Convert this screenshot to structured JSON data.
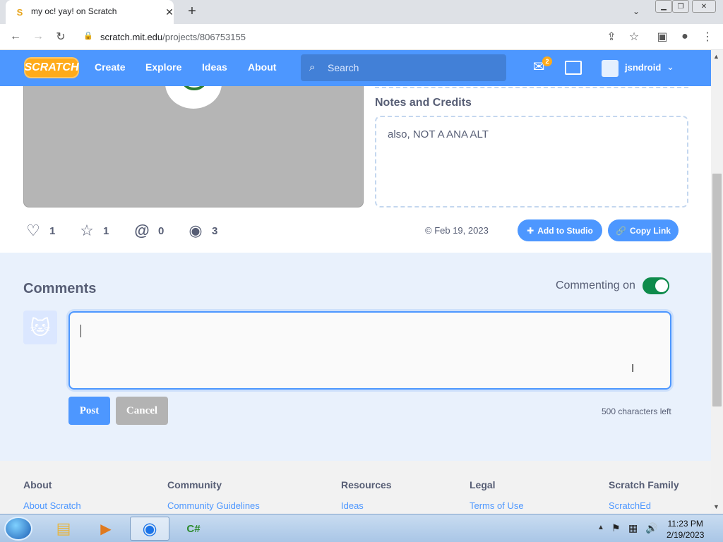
{
  "browser": {
    "tab_title": "my oc! yay! on Scratch",
    "new_tab": "+",
    "url_domain": "scratch.mit.edu",
    "url_path": "/projects/806753155"
  },
  "nav": {
    "logo": "SCRATCH",
    "links": [
      "Create",
      "Explore",
      "Ideas",
      "About"
    ],
    "search_placeholder": "Search",
    "message_count": "2",
    "username": "jsndroid"
  },
  "project": {
    "notes_heading": "Notes and Credits",
    "notes_text": "also, NOT A ANA ALT",
    "stats": {
      "loves": "1",
      "favorites": "1",
      "remixes": "0",
      "views": "3"
    },
    "date": "© Feb 19, 2023",
    "add_to_studio": "Add to Studio",
    "copy_link": "Copy Link"
  },
  "comments": {
    "heading": "Comments",
    "commenting_label": "Commenting on",
    "commenting_enabled": true,
    "post_label": "Post",
    "cancel_label": "Cancel",
    "chars_left": "500 characters left"
  },
  "footer": {
    "columns": [
      {
        "heading": "About",
        "link": "About Scratch"
      },
      {
        "heading": "Community",
        "link": "Community Guidelines"
      },
      {
        "heading": "Resources",
        "link": "Ideas"
      },
      {
        "heading": "Legal",
        "link": "Terms of Use"
      },
      {
        "heading": "Scratch Family",
        "link": "ScratchEd"
      }
    ]
  },
  "taskbar": {
    "time": "11:23 PM",
    "date": "2/19/2023"
  },
  "colors": {
    "scratch_blue": "#4d97ff",
    "toggle_on": "#0f8b4b",
    "text": "#575e75"
  }
}
